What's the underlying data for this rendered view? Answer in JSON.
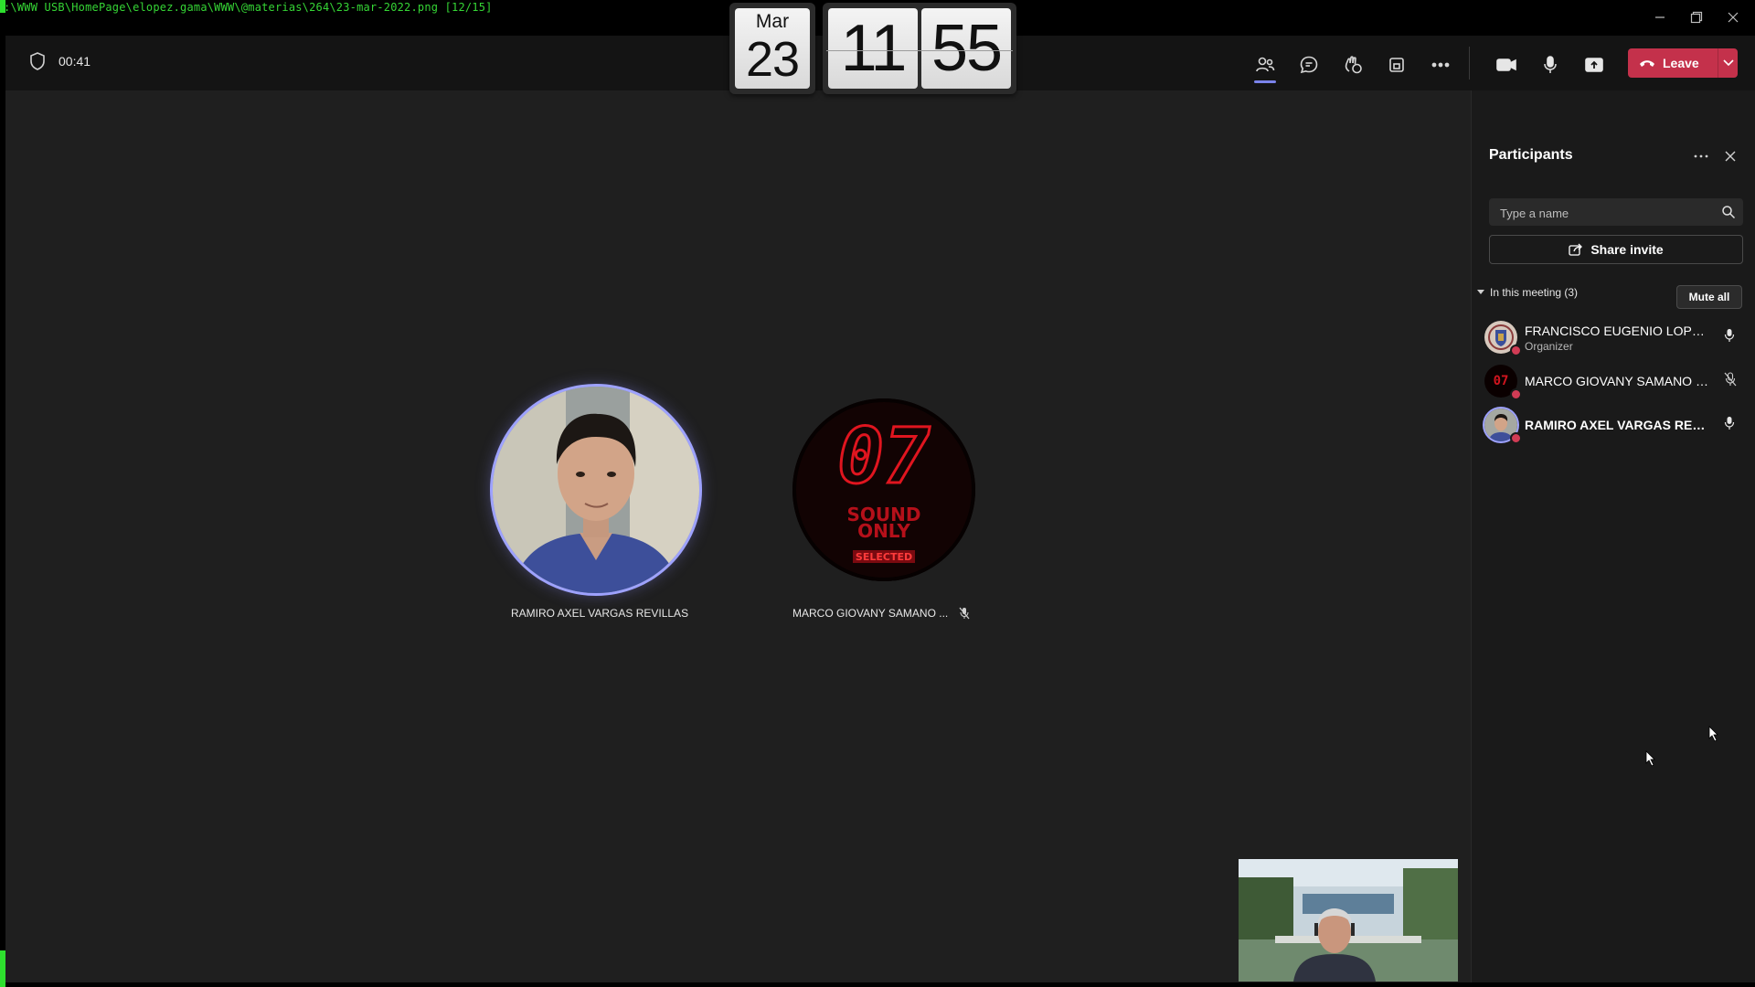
{
  "window": {
    "title_path": ":\\WWW USB\\HomePage\\elopez.gama\\WWW\\@materias\\264\\23-mar-2022.png [12/15]"
  },
  "meeting": {
    "duration": "00:41"
  },
  "flip_clock": {
    "month": "Mar",
    "day": "23",
    "hour": "11",
    "minute": "55"
  },
  "toolbar": {
    "leave_label": "Leave",
    "icons": [
      "participants-icon",
      "chat-icon",
      "reactions-icon",
      "view-icon",
      "more-icon",
      "camera-icon",
      "microphone-icon",
      "share-screen-icon"
    ]
  },
  "stage": {
    "participants": [
      {
        "name": "RAMIRO AXEL VARGAS REVILLAS"
      },
      {
        "name": "MARCO GIOVANY SAMANO ...",
        "muted": true,
        "avatar_text": [
          "07",
          "SOUND",
          "ONLY",
          "SELECTED"
        ]
      }
    ]
  },
  "panel": {
    "title": "Participants",
    "search_placeholder": "Type a name",
    "share_invite": "Share invite",
    "section_label": "In this meeting (3)",
    "mute_all": "Mute all",
    "people": [
      {
        "name": "FRANCISCO EUGENIO LOPEZ G...",
        "role": "Organizer",
        "mic": "on"
      },
      {
        "name": "MARCO GIOVANY SAMANO RA...",
        "role": "",
        "mic": "muted"
      },
      {
        "name": "RAMIRO AXEL VARGAS REVILL...",
        "role": "",
        "mic": "on"
      }
    ]
  },
  "colors": {
    "accent": "#7b83eb",
    "leave": "#c4314b",
    "background": "#1f1f1f"
  }
}
